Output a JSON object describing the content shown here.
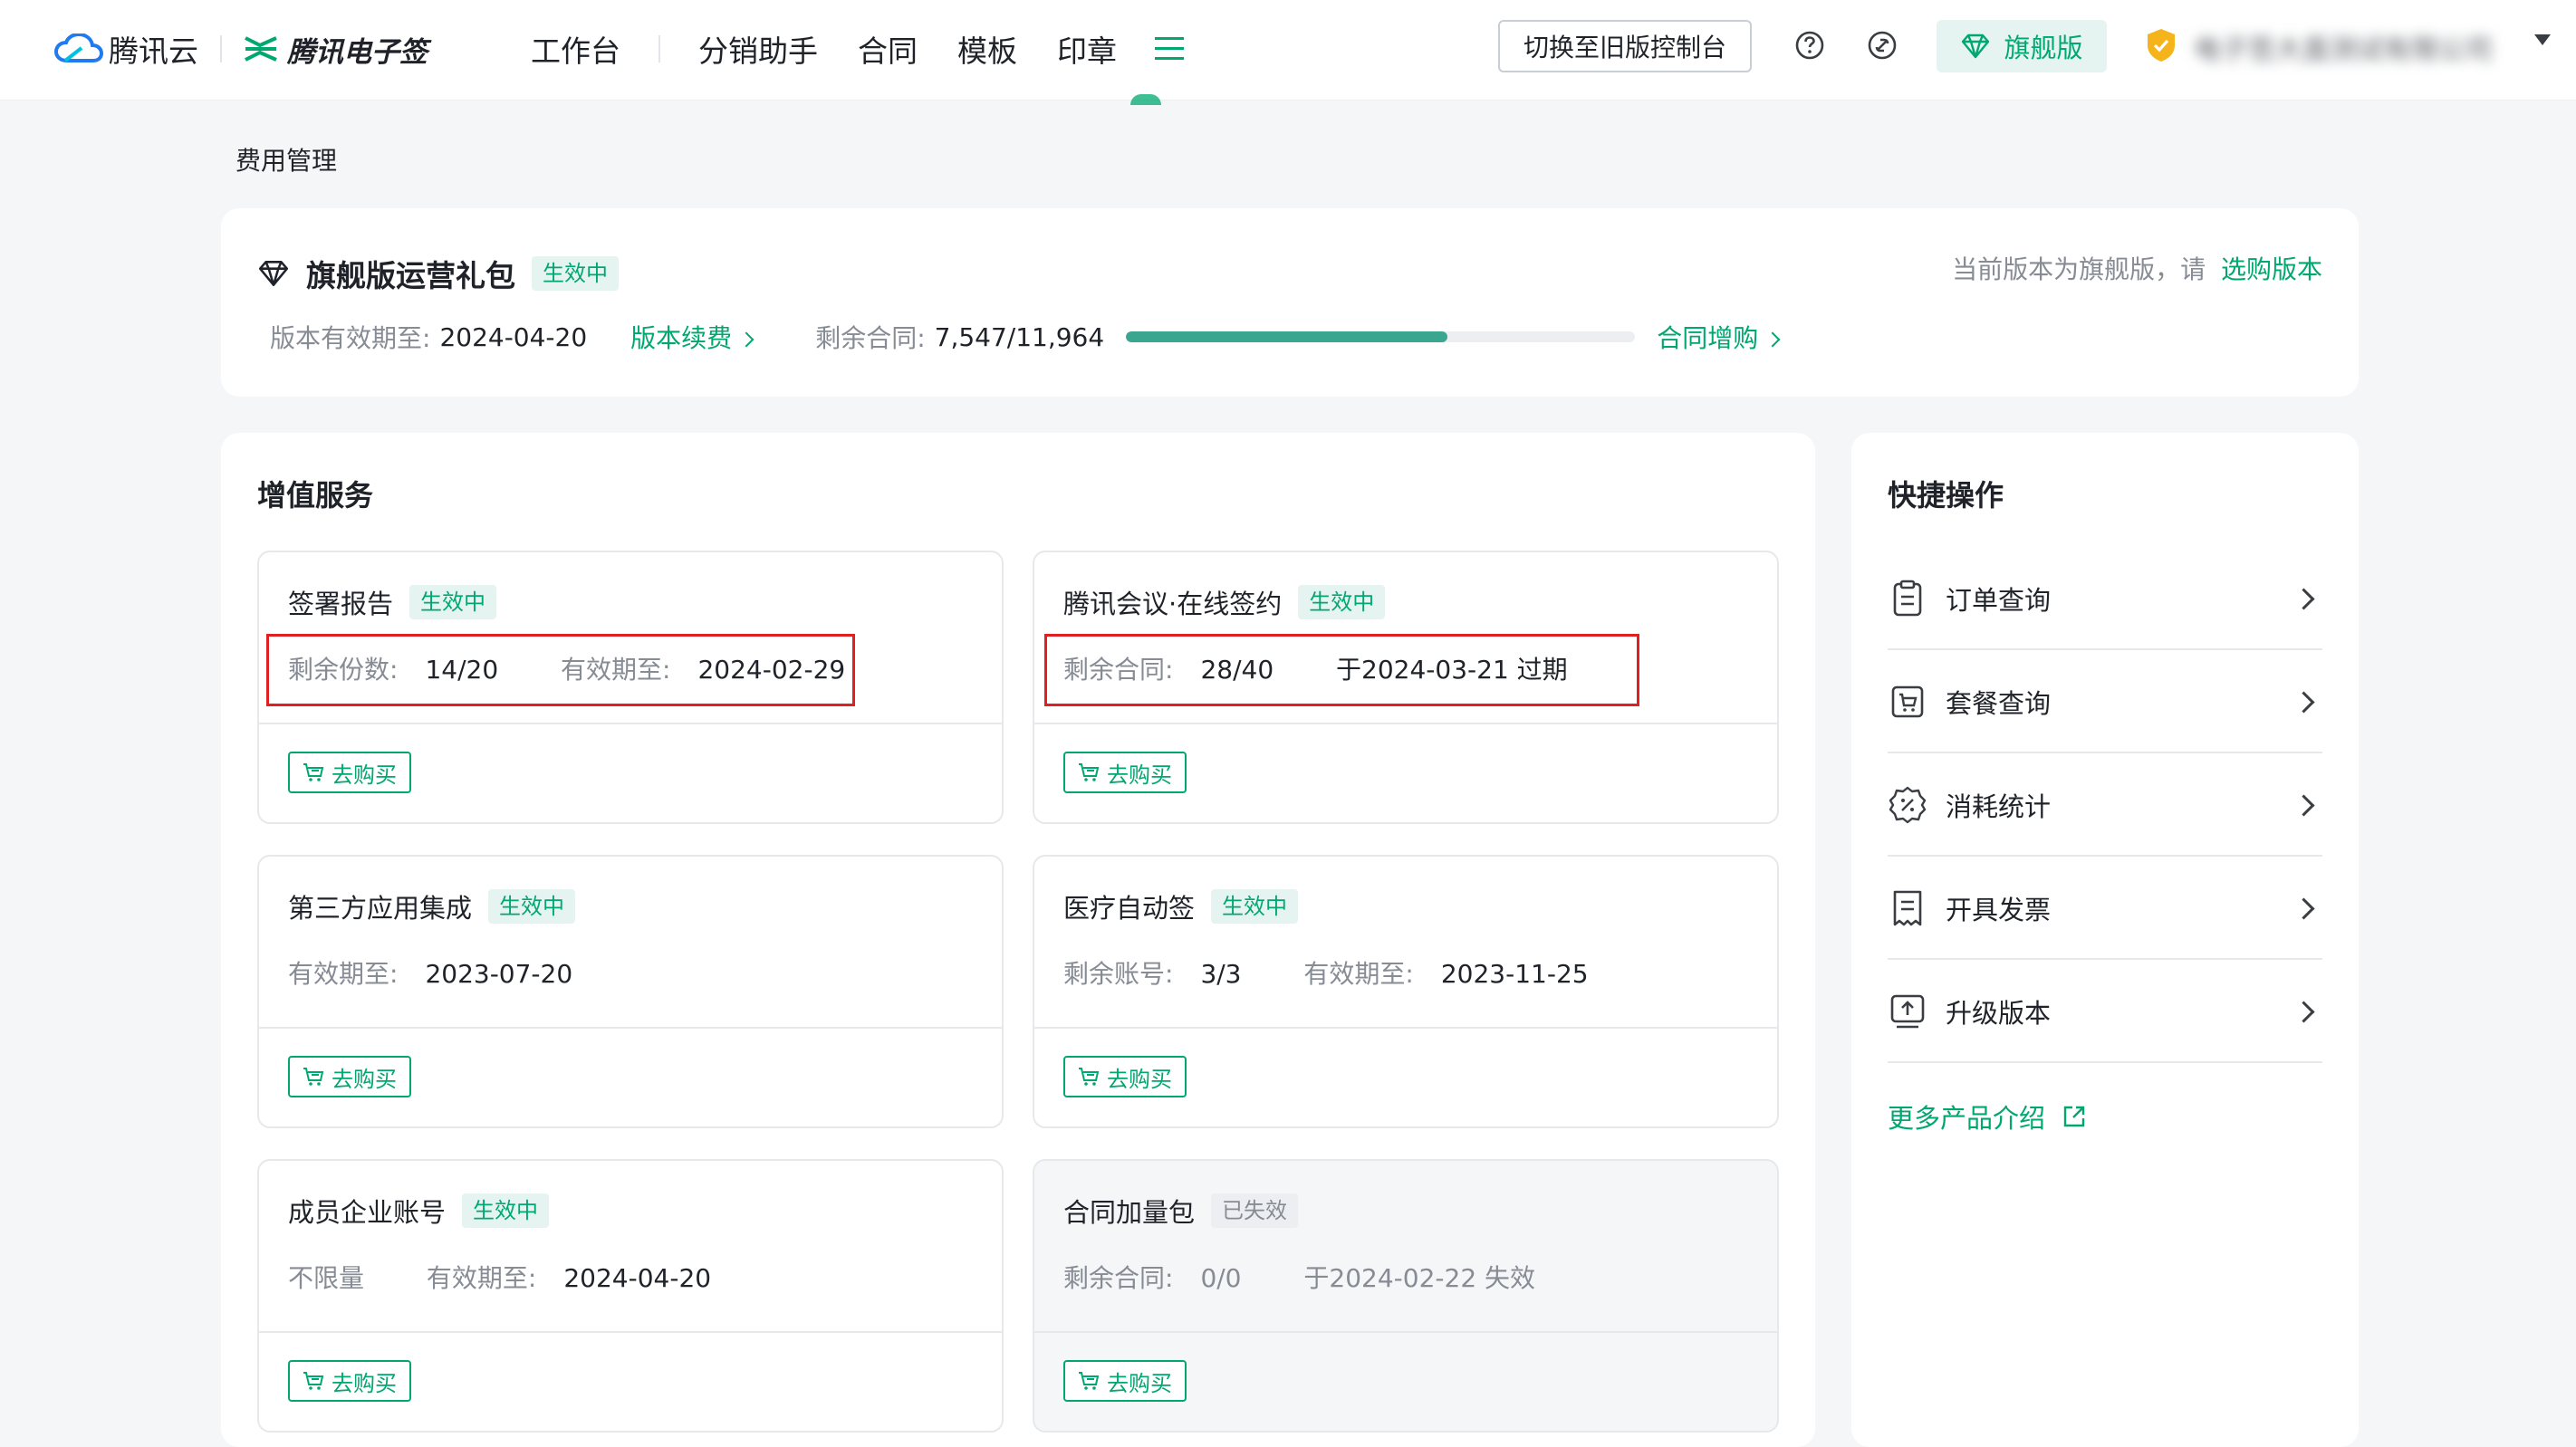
{
  "nav": {
    "cloud_brand": "腾讯云",
    "esign_brand": "腾讯电子签",
    "items": [
      "工作台",
      "分销助手",
      "合同",
      "模板",
      "印章"
    ],
    "switch_label": "切换至旧版控制台",
    "edition_label": "旗舰版",
    "org_name": "电子签大直测试有限公司",
    "icons": [
      "help-icon",
      "link-icon",
      "diamond-icon",
      "shield-icon",
      "menu-icon"
    ]
  },
  "page": {
    "title": "费用管理"
  },
  "package": {
    "title": "旗舰版运营礼包",
    "status": "生效中",
    "valid_label": "版本有效期至:",
    "valid_value": "2024-04-20",
    "renew_label": "版本续费",
    "remaining_label": "剩余合同:",
    "remaining_value": "7,547/11,964",
    "remaining_fraction": 0.6308,
    "add_label": "合同增购",
    "current_text": "当前版本为旗舰版，请",
    "choose_label": "选购版本"
  },
  "services": {
    "title": "增值服务",
    "buy_label": "去购买",
    "items": [
      {
        "name": "签署报告",
        "status": "生效中",
        "active": true,
        "l1": "剩余份数:",
        "v1": "14/20",
        "l2": "有效期至:",
        "v2": "2024-02-29"
      },
      {
        "name": "腾讯会议·在线签约",
        "status": "生效中",
        "active": true,
        "l1": "剩余合同:",
        "v1": "28/40",
        "l2": "",
        "v2": "于2024-03-21 过期"
      },
      {
        "name": "第三方应用集成",
        "status": "生效中",
        "active": true,
        "l1": "有效期至:",
        "v1": "2023-07-20",
        "l2": "",
        "v2": ""
      },
      {
        "name": "医疗自动签",
        "status": "生效中",
        "active": true,
        "l1": "剩余账号:",
        "v1": "3/3",
        "l2": "有效期至:",
        "v2": "2023-11-25"
      },
      {
        "name": "成员企业账号",
        "status": "生效中",
        "active": true,
        "l1": "",
        "v1": "不限量",
        "l2": "有效期至:",
        "v2": "2024-04-20"
      },
      {
        "name": "合同加量包",
        "status": "已失效",
        "active": false,
        "l1": "剩余合同:",
        "v1": "0/0",
        "l2": "",
        "v2": "于2024-02-22 失效"
      }
    ]
  },
  "quick": {
    "title": "快捷操作",
    "items": [
      "订单查询",
      "套餐查询",
      "消耗统计",
      "开具发票",
      "升级版本"
    ],
    "more_label": "更多产品介绍"
  },
  "colors": {
    "accent": "#00a870",
    "highlight": "#e02020",
    "text": "#1f2329",
    "muted": "#868b94"
  }
}
